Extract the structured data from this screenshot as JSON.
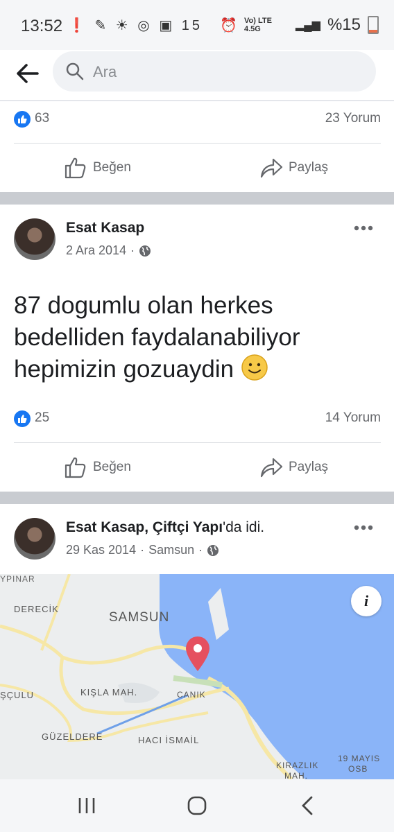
{
  "status_bar": {
    "time": "13:52",
    "notification_count": "15",
    "network": "Vo) LTE 4.5G",
    "battery": "%15"
  },
  "search": {
    "placeholder": "Ara"
  },
  "post_prev": {
    "reaction_count": "63",
    "comment_count": "23 Yorum",
    "like_label": "Beğen",
    "share_label": "Paylaş"
  },
  "post1": {
    "author": "Esat Kasap",
    "date": "2 Ara 2014",
    "privacy_icon": "globe-icon",
    "text": "87 dogumlu olan herkes bedelliden faydalanabiliyor hepimizin gozuaydin",
    "emoji": "🙂",
    "reaction_count": "25",
    "comment_count": "14 Yorum",
    "like_label": "Beğen",
    "share_label": "Paylaş"
  },
  "post2": {
    "author": "Esat Kasap",
    "place": "Çiftçi Yapı",
    "place_suffix": "'da idi.",
    "date": "29 Kas 2014",
    "location": "Samsun",
    "privacy_icon": "globe-icon",
    "map": {
      "labels": [
        "YPINAR",
        "DERECİK",
        "SAMSUN",
        "ŞÇULU",
        "KIŞLA MAH.",
        "CANIK",
        "GÜZELDERE",
        "HACI İSMAİL",
        "KIRAZLIK",
        "MAH.",
        "19 MAYIS",
        "OSB"
      ],
      "info_label": "i"
    }
  },
  "colors": {
    "accent": "#1877f2",
    "water": "#8ab4f8",
    "pin": "#e5505f"
  }
}
